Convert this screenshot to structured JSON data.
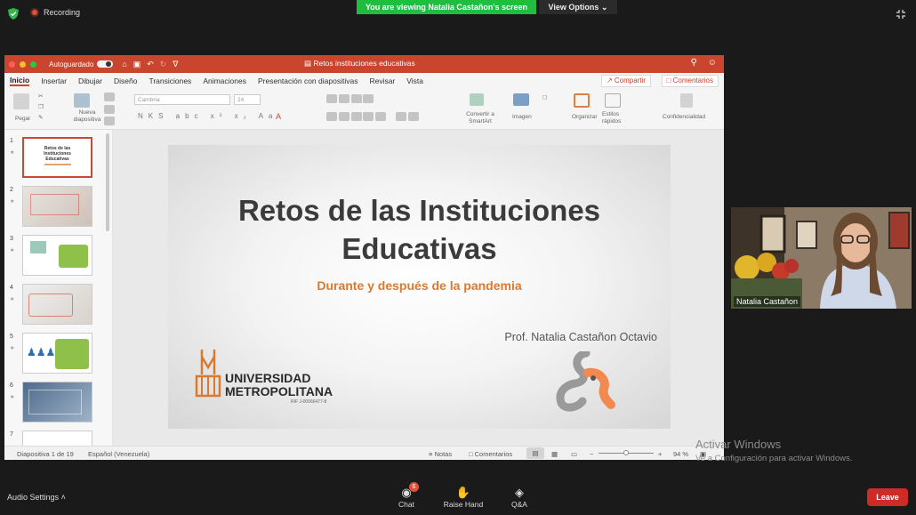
{
  "zoom_meeting": {
    "recording_label": "Recording",
    "viewing_banner": "You are viewing Natalia Castañon's screen",
    "view_options_label": "View Options",
    "participant_name": "Natalia Castañon"
  },
  "ppt": {
    "autosave_label": "Autoguardado",
    "document_title": "Retos instituciones educativas",
    "tabs": [
      "Inicio",
      "Insertar",
      "Dibujar",
      "Diseño",
      "Transiciones",
      "Animaciones",
      "Presentación con diapositivas",
      "Revisar",
      "Vista"
    ],
    "share_label": "Compartir",
    "comments_label": "Comentarios",
    "ribbon": {
      "paste": "Pegar",
      "new_slide": "Nueva diapositiva",
      "font_name": "Cambria",
      "font_size": "24",
      "convert_smartart": "Convertir a SmartArt",
      "image": "Imagen",
      "organize": "Organizar",
      "quick_styles": "Estilos rápidos",
      "confidentiality": "Confidencialidad"
    },
    "thumbnails": [
      {
        "num": "1",
        "title": "Retos de las Instituciones Educativas"
      },
      {
        "num": "2"
      },
      {
        "num": "3"
      },
      {
        "num": "4"
      },
      {
        "num": "5"
      },
      {
        "num": "6"
      },
      {
        "num": "7"
      }
    ],
    "slide": {
      "title_line1": "Retos de las Instituciones",
      "title_line2": "Educativas",
      "subtitle": "Durante y después de la pandemia",
      "presenter": "Prof. Natalia Castañon Octavio",
      "university_line1": "UNIVERSIDAD",
      "university_line2": "METROPOLITANA",
      "rif": "RIF J-00066477-8"
    },
    "status_bar": {
      "slide_counter": "Diapositiva 1 de 19",
      "language": "Español (Venezuela)",
      "notes": "Notas",
      "comments": "Comentarios",
      "zoom": "94 %"
    }
  },
  "windows_activation": {
    "line1": "Activar Windows",
    "line2": "Ve a Configuración para activar Windows."
  },
  "bottom_bar": {
    "audio_settings": "Audio Settings",
    "chat": "Chat",
    "chat_badge": "6",
    "raise_hand": "Raise Hand",
    "qa": "Q&A",
    "leave": "Leave"
  }
}
